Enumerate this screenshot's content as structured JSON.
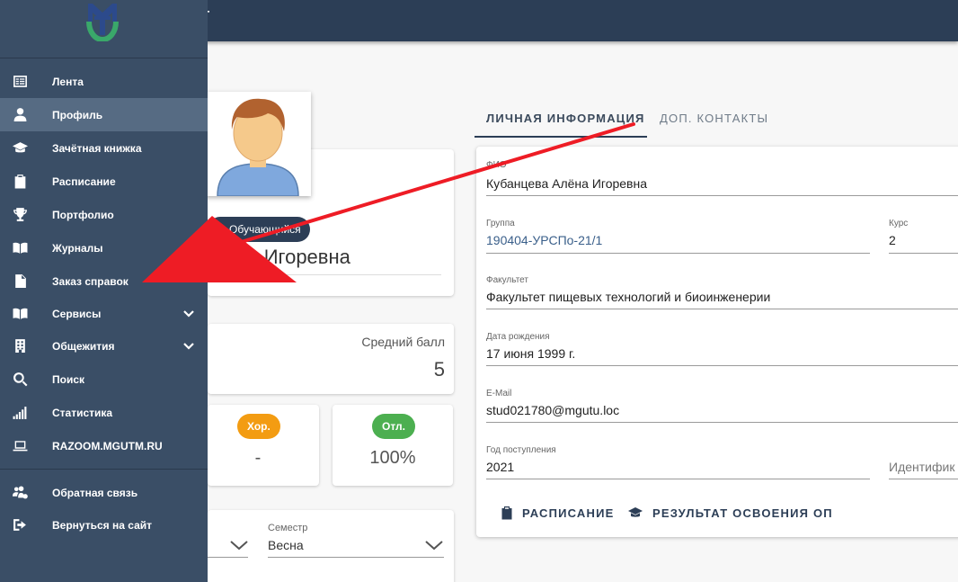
{
  "appbar": {
    "title": "Т"
  },
  "sidebar": {
    "items": [
      {
        "label": "Лента",
        "icon": "feed-icon"
      },
      {
        "label": "Профиль",
        "icon": "person-icon"
      },
      {
        "label": "Зачётная книжка",
        "icon": "graduation-cap-icon"
      },
      {
        "label": "Расписание",
        "icon": "clipboard-icon"
      },
      {
        "label": "Портфолио",
        "icon": "trophy-icon"
      },
      {
        "label": "Журналы",
        "icon": "book-open-icon"
      },
      {
        "label": "Заказ справок",
        "icon": "document-icon"
      },
      {
        "label": "Сервисы",
        "icon": "book-services-icon"
      },
      {
        "label": "Общежития",
        "icon": "building-icon"
      },
      {
        "label": "Поиск",
        "icon": "search-icon"
      },
      {
        "label": "Статистика",
        "icon": "signal-bars-icon"
      },
      {
        "label": "RAZOOM.MGUTM.RU",
        "icon": "laptop-icon"
      },
      {
        "label": "Обратная связь",
        "icon": "users-icon"
      },
      {
        "label": "Вернуться на сайт",
        "icon": "sign-out-icon"
      }
    ],
    "active_index": 1
  },
  "profile": {
    "role": "Обучающийся",
    "name_partial": "ёна Игоревна",
    "avg_label": "Средний балл",
    "avg_value": "5",
    "grade_good_label": "Хор.",
    "grade_good_value": "-",
    "grade_excellent_label": "Отл.",
    "grade_excellent_value": "100%",
    "semester_label": "Семестр",
    "semester_value": "Весна"
  },
  "tabs": [
    {
      "label": "ЛИЧНАЯ ИНФОРМАЦИЯ",
      "active": true
    },
    {
      "label": "ДОП. КОНТАКТЫ",
      "active": false
    }
  ],
  "info": {
    "fio_label": "ФИО",
    "fio_value": "Кубанцева Алёна Игоревна",
    "group_label": "Группа",
    "group_value": "190404-УРСПо-21/1",
    "course_label": "Курс",
    "course_value": "2",
    "faculty_label": "Факультет",
    "faculty_value": "Факультет пищевых технологий и биоинженерии",
    "birth_label": "Дата рождения",
    "birth_value": "17 июня 1999 г.",
    "email_label": "E-Mail",
    "email_value": "stud021780@mgutu.loc",
    "year_label": "Год поступления",
    "year_value": "2021",
    "id_placeholder": "Идентифик"
  },
  "actions": {
    "schedule": "РАСПИСАНИЕ",
    "results": "РЕЗУЛЬТАТ ОСВОЕНИЯ ОП"
  },
  "colors": {
    "sidebar_bg": "#3a4e66",
    "appbar_bg": "#2c3e56",
    "active_item": "#566b83",
    "grade_good": "#f39c12",
    "grade_excellent": "#4caf50",
    "arrow": "#ee1c25"
  }
}
